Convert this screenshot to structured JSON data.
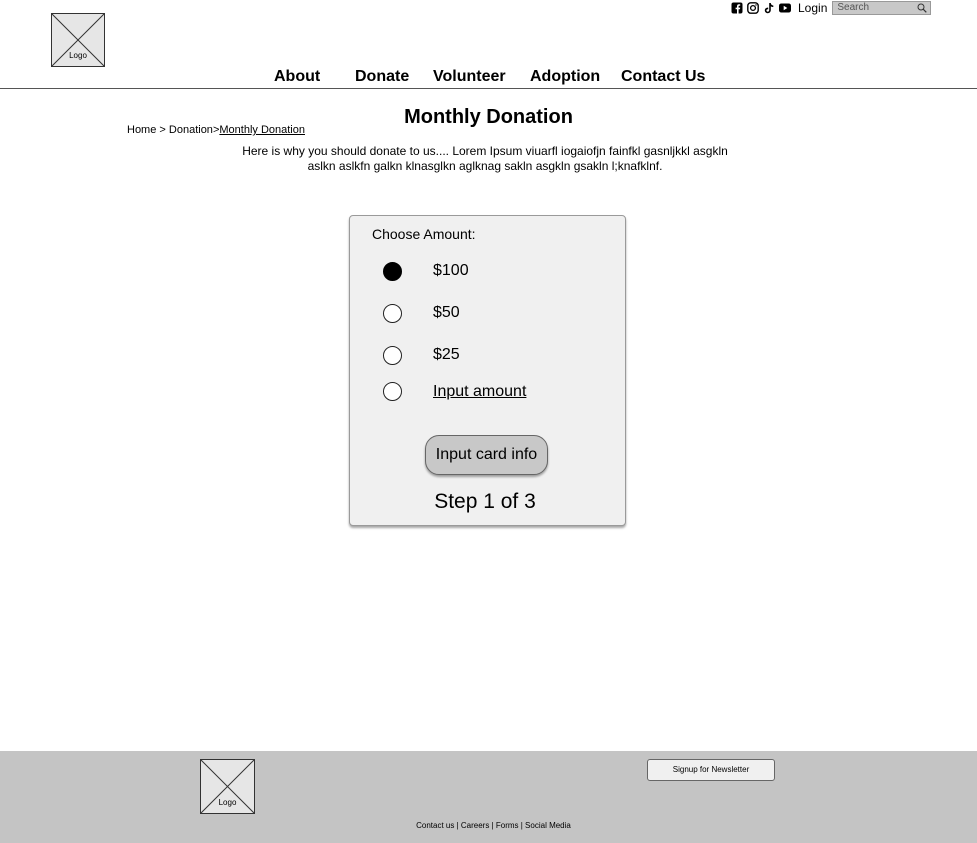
{
  "header": {
    "logo_label": "Logo",
    "social_icons": [
      "facebook-icon",
      "instagram-icon",
      "tiktok-icon",
      "youtube-icon"
    ],
    "login_label": "Login",
    "search_placeholder": "Search"
  },
  "nav": [
    {
      "label": "About"
    },
    {
      "label": "Donate"
    },
    {
      "label": "Volunteer"
    },
    {
      "label": "Adoption"
    },
    {
      "label": "Contact Us"
    }
  ],
  "breadcrumb": {
    "home": "Home",
    "sep1": " > ",
    "donation": "Donation",
    "sep2": ">",
    "current": "Monthly Donation"
  },
  "page": {
    "title": "Monthly Donation",
    "intro": "Here is why you should donate to us.... Lorem Ipsum viuarfl iogaiofjn fainfkl gasnljkkl asgkln aslkn aslkfn galkn klnasglkn aglknag sakln asgkln gsakln l;knafklnf."
  },
  "donation": {
    "choose_label": "Choose Amount:",
    "options": [
      {
        "label": "$100",
        "selected": true
      },
      {
        "label": "$50",
        "selected": false
      },
      {
        "label": "$25",
        "selected": false
      },
      {
        "label": "Input amount",
        "selected": false
      }
    ],
    "button_label": "Input card info",
    "step_label": "Step 1 of 3"
  },
  "footer": {
    "logo_label": "Logo",
    "newsletter_label": "Signup for Newsletter",
    "links": "Contact us | Careers | Forms | Social Media"
  }
}
